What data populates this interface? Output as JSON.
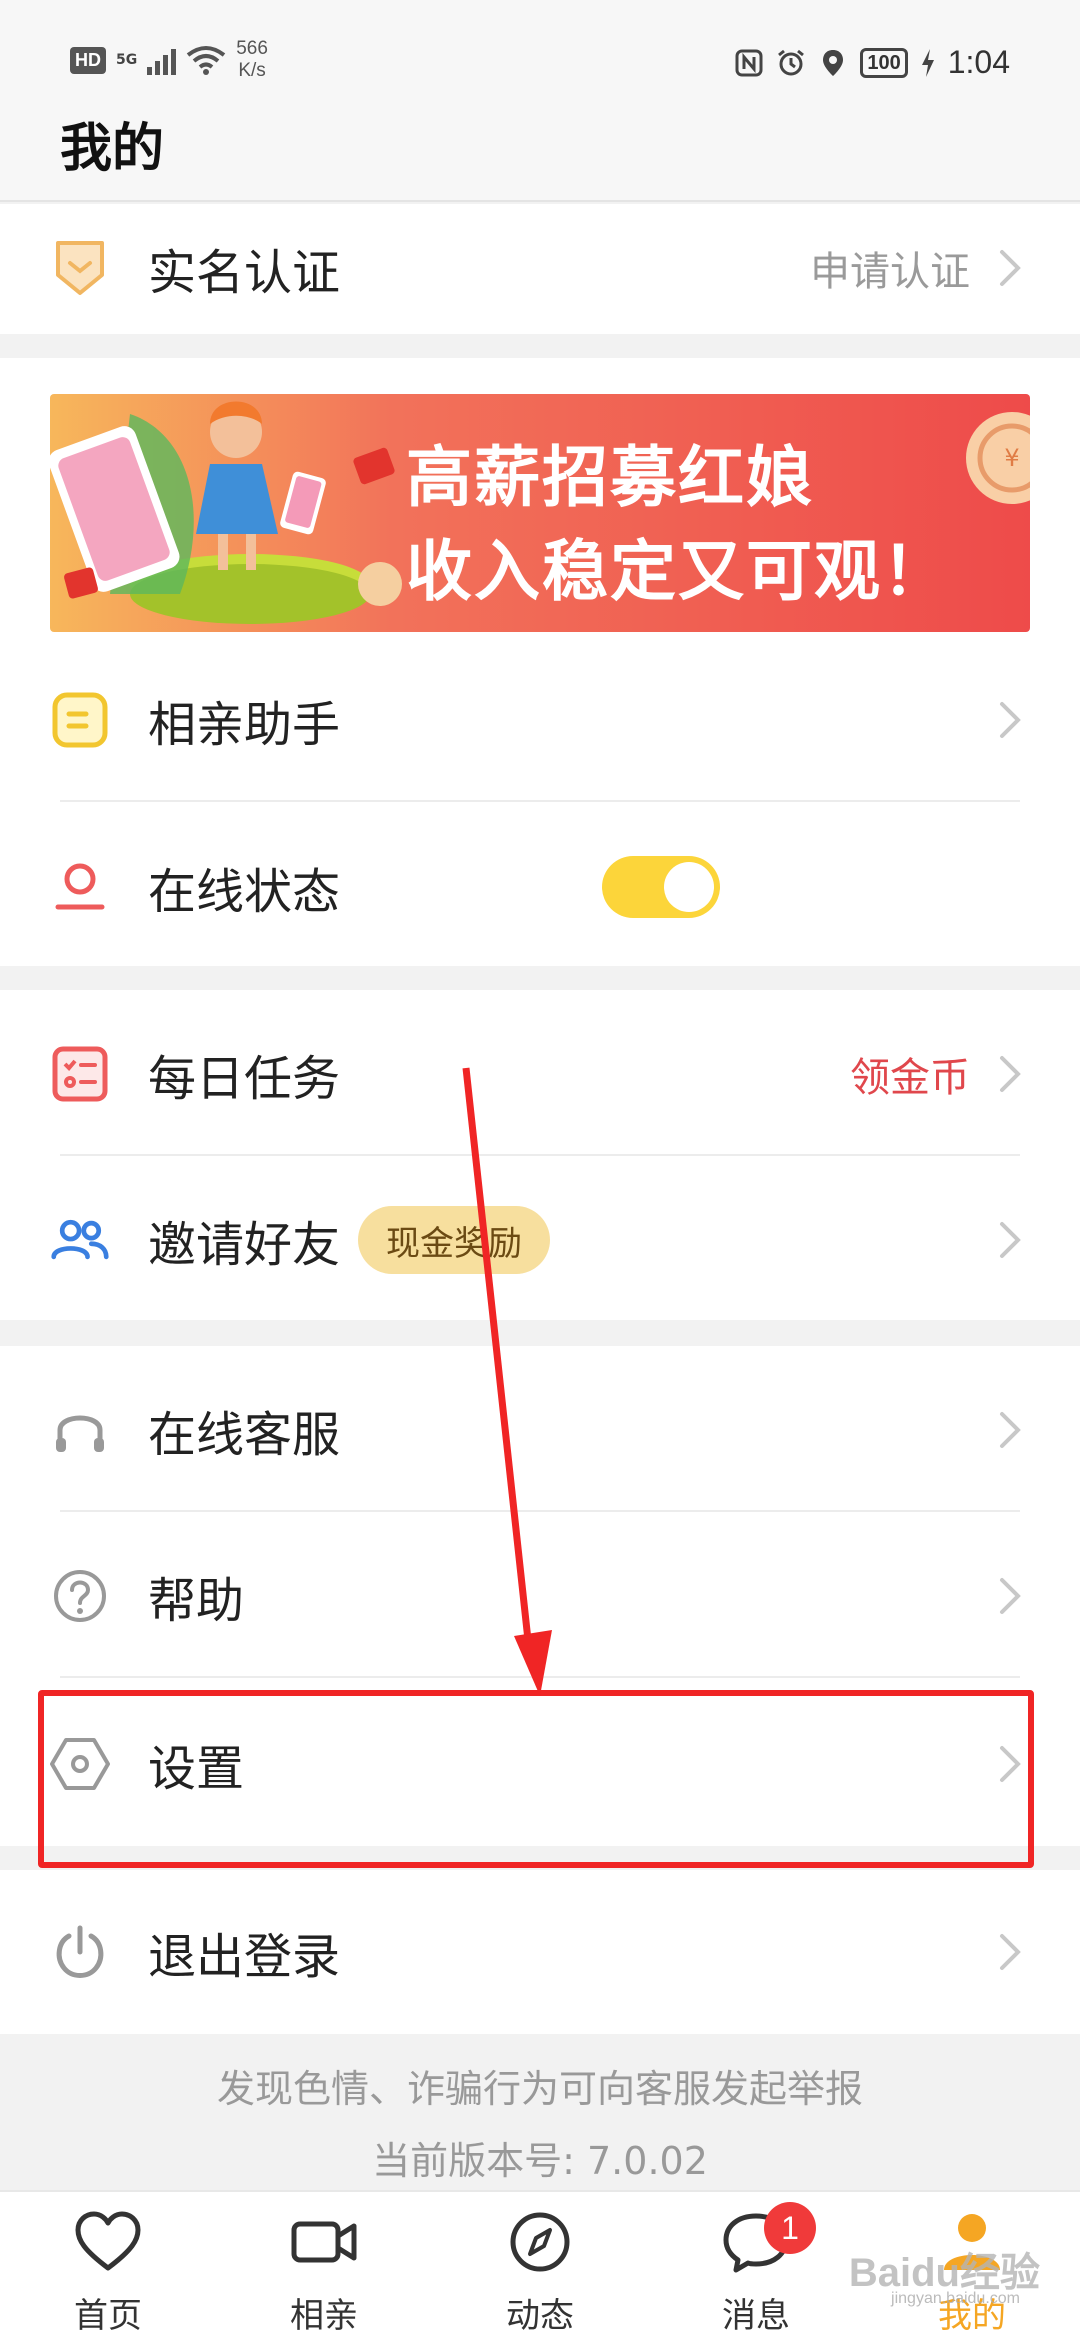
{
  "status_bar": {
    "hd": "HD",
    "network": "5G",
    "speed_value": "566",
    "speed_unit": "K/s",
    "battery": "100",
    "time": "1:04"
  },
  "header": {
    "title": "我的"
  },
  "verify": {
    "label": "实名认证",
    "action": "申请认证"
  },
  "banner": {
    "line1": "高薪招募红娘",
    "line2": "收入稳定又可观！"
  },
  "menu_group1": {
    "assistant": {
      "label": "相亲助手"
    },
    "online_status": {
      "label": "在线状态",
      "toggle_on": true
    }
  },
  "menu_group2": {
    "daily_task": {
      "label": "每日任务",
      "action": "领金币"
    },
    "invite": {
      "label": "邀请好友",
      "pill": "现金奖励"
    }
  },
  "menu_group3": {
    "service": {
      "label": "在线客服"
    },
    "help": {
      "label": "帮助"
    },
    "settings": {
      "label": "设置"
    }
  },
  "logout": {
    "label": "退出登录"
  },
  "footer": {
    "report": "发现色情、诈骗行为可向客服发起举报",
    "version": "当前版本号: 7.0.02"
  },
  "tabbar": {
    "tabs": [
      {
        "label": "首页",
        "icon": "heart-icon"
      },
      {
        "label": "相亲",
        "icon": "video-camera-icon"
      },
      {
        "label": "动态",
        "icon": "compass-icon"
      },
      {
        "label": "消息",
        "icon": "chat-bubble-icon",
        "badge": "1"
      },
      {
        "label": "我的",
        "icon": "user-icon",
        "active": true
      }
    ]
  },
  "watermark": {
    "main": "Baidu经验",
    "sub": "jingyan.baidu.com"
  },
  "colors": {
    "accent": "#f5a623",
    "toggle": "#fcd53a",
    "annotation": "#f02525",
    "gold_action": "#e0474c"
  }
}
